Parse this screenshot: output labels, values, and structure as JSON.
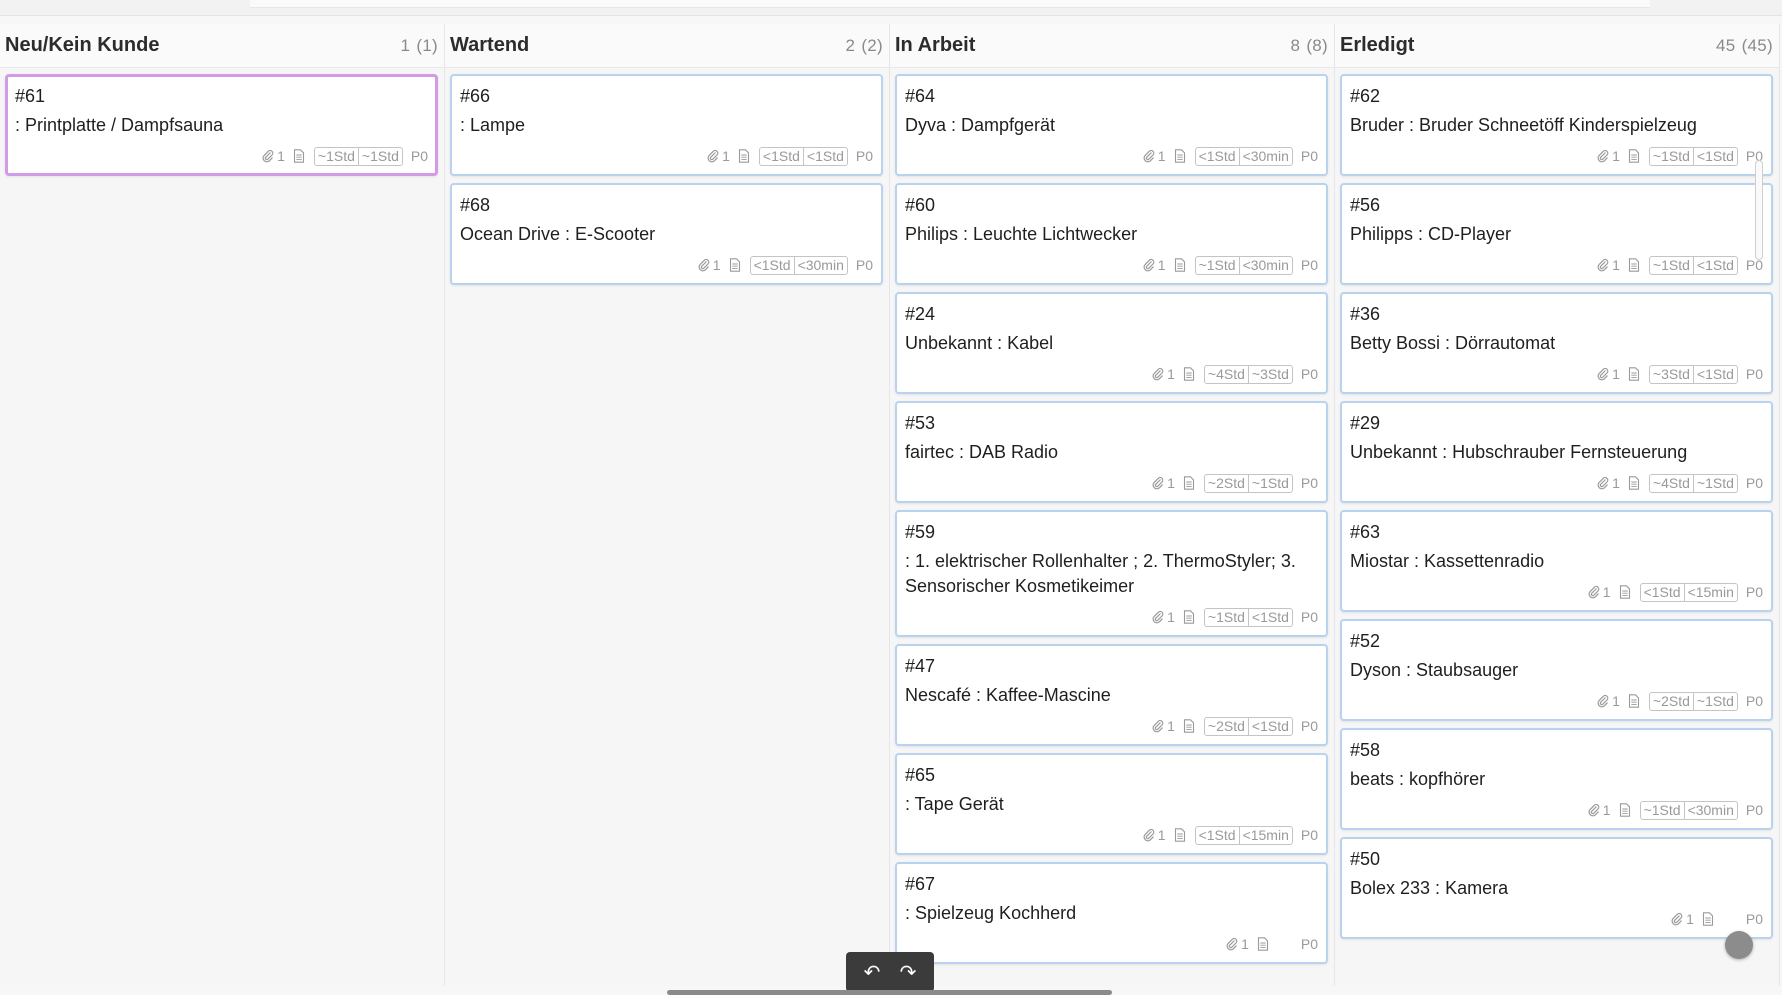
{
  "columns": [
    {
      "title": "Neu/Kein Kunde",
      "count": "1",
      "total": "(1)",
      "cards": [
        {
          "id": "#61",
          "title": ": Printplatte / Dampfsauna",
          "attachments": "1",
          "est1": "~1Std",
          "est2": "~1Std",
          "priority": "P0",
          "selected": true
        }
      ]
    },
    {
      "title": "Wartend",
      "count": "2",
      "total": "(2)",
      "cards": [
        {
          "id": "#66",
          "title": ": Lampe",
          "attachments": "1",
          "est1": "<1Std",
          "est2": "<1Std",
          "priority": "P0"
        },
        {
          "id": "#68",
          "title": "Ocean Drive : E-Scooter",
          "attachments": "1",
          "est1": "<1Std",
          "est2": "<30min",
          "priority": "P0"
        }
      ]
    },
    {
      "title": "In Arbeit",
      "count": "8",
      "total": "(8)",
      "cards": [
        {
          "id": "#64",
          "title": "Dyva : Dampfgerät",
          "attachments": "1",
          "est1": "<1Std",
          "est2": "<30min",
          "priority": "P0"
        },
        {
          "id": "#60",
          "title": "Philips : Leuchte Lichtwecker",
          "attachments": "1",
          "est1": "~1Std",
          "est2": "<30min",
          "priority": "P0"
        },
        {
          "id": "#24",
          "title": "Unbekannt : Kabel",
          "attachments": "1",
          "est1": "~4Std",
          "est2": "~3Std",
          "priority": "P0"
        },
        {
          "id": "#53",
          "title": "fairtec : DAB Radio",
          "attachments": "1",
          "est1": "~2Std",
          "est2": "~1Std",
          "priority": "P0"
        },
        {
          "id": "#59",
          "title": ": 1. elektrischer Rollenhalter ; 2. ThermoStyler; 3. Sensorischer Kosmetikeimer",
          "attachments": "1",
          "est1": "~1Std",
          "est2": "<1Std",
          "priority": "P0"
        },
        {
          "id": "#47",
          "title": "Nescafé : Kaffee-Mascine",
          "attachments": "1",
          "est1": "~2Std",
          "est2": "<1Std",
          "priority": "P0"
        },
        {
          "id": "#65",
          "title": ": Tape Gerät",
          "attachments": "1",
          "est1": "<1Std",
          "est2": "<15min",
          "priority": "P0"
        },
        {
          "id": "#67",
          "title": ": Spielzeug Kochherd",
          "attachments": "1",
          "est1": "",
          "est2": "",
          "priority": "P0"
        }
      ]
    },
    {
      "title": "Erledigt",
      "count": "45",
      "total": "(45)",
      "cards": [
        {
          "id": "#62",
          "title": "Bruder : Bruder Schneetöff Kinderspielzeug",
          "attachments": "1",
          "est1": "~1Std",
          "est2": "<1Std",
          "priority": "P0"
        },
        {
          "id": "#56",
          "title": "Philipps : CD-Player",
          "attachments": "1",
          "est1": "~1Std",
          "est2": "<1Std",
          "priority": "P0"
        },
        {
          "id": "#36",
          "title": "Betty Bossi : Dörrautomat",
          "attachments": "1",
          "est1": "~3Std",
          "est2": "<1Std",
          "priority": "P0"
        },
        {
          "id": "#29",
          "title": "Unbekannt : Hubschrauber Fernsteuerung",
          "attachments": "1",
          "est1": "~4Std",
          "est2": "~1Std",
          "priority": "P0"
        },
        {
          "id": "#63",
          "title": "Miostar : Kassettenradio",
          "attachments": "1",
          "est1": "<1Std",
          "est2": "<15min",
          "priority": "P0"
        },
        {
          "id": "#52",
          "title": "Dyson : Staubsauger",
          "attachments": "1",
          "est1": "~2Std",
          "est2": "~1Std",
          "priority": "P0"
        },
        {
          "id": "#58",
          "title": "beats : kopfhörer",
          "attachments": "1",
          "est1": "~1Std",
          "est2": "<30min",
          "priority": "P0"
        },
        {
          "id": "#50",
          "title": "Bolex 233 : Kamera",
          "attachments": "1",
          "est1": "",
          "est2": "",
          "priority": "P0"
        }
      ]
    }
  ],
  "toolbar": {
    "undo_icon": "undo-icon",
    "redo_icon": "redo-icon"
  },
  "colors": {
    "card_border": "#b9d3ef",
    "selected_border": "#d39be6",
    "toolbar_bg": "#3b3b3b"
  }
}
